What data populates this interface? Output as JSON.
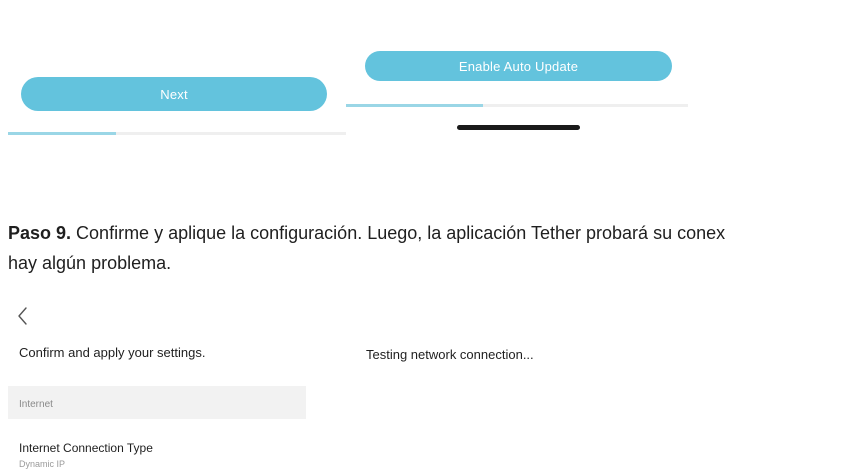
{
  "buttons": {
    "next_label": "Next",
    "auto_update_label": "Enable Auto Update"
  },
  "progress": {
    "left_fraction": 0.32,
    "right_fraction": 0.4
  },
  "step": {
    "number_label": "Paso 9.",
    "line1_rest": " Confirme y aplique la configuración. Luego, la aplicación Tether probará su conex",
    "line2": "hay algún problema."
  },
  "confirm_screen": {
    "back_icon": "chevron-left-icon",
    "title": "Confirm and apply your settings.",
    "section_label": "Internet",
    "connection_type_label": "Internet Connection Type",
    "connection_type_value": "Dynamic IP"
  },
  "testing_screen": {
    "status_text": "Testing network connection..."
  },
  "colors": {
    "accent": "#63c3dd",
    "progress_fill": "#9ad6e6"
  }
}
